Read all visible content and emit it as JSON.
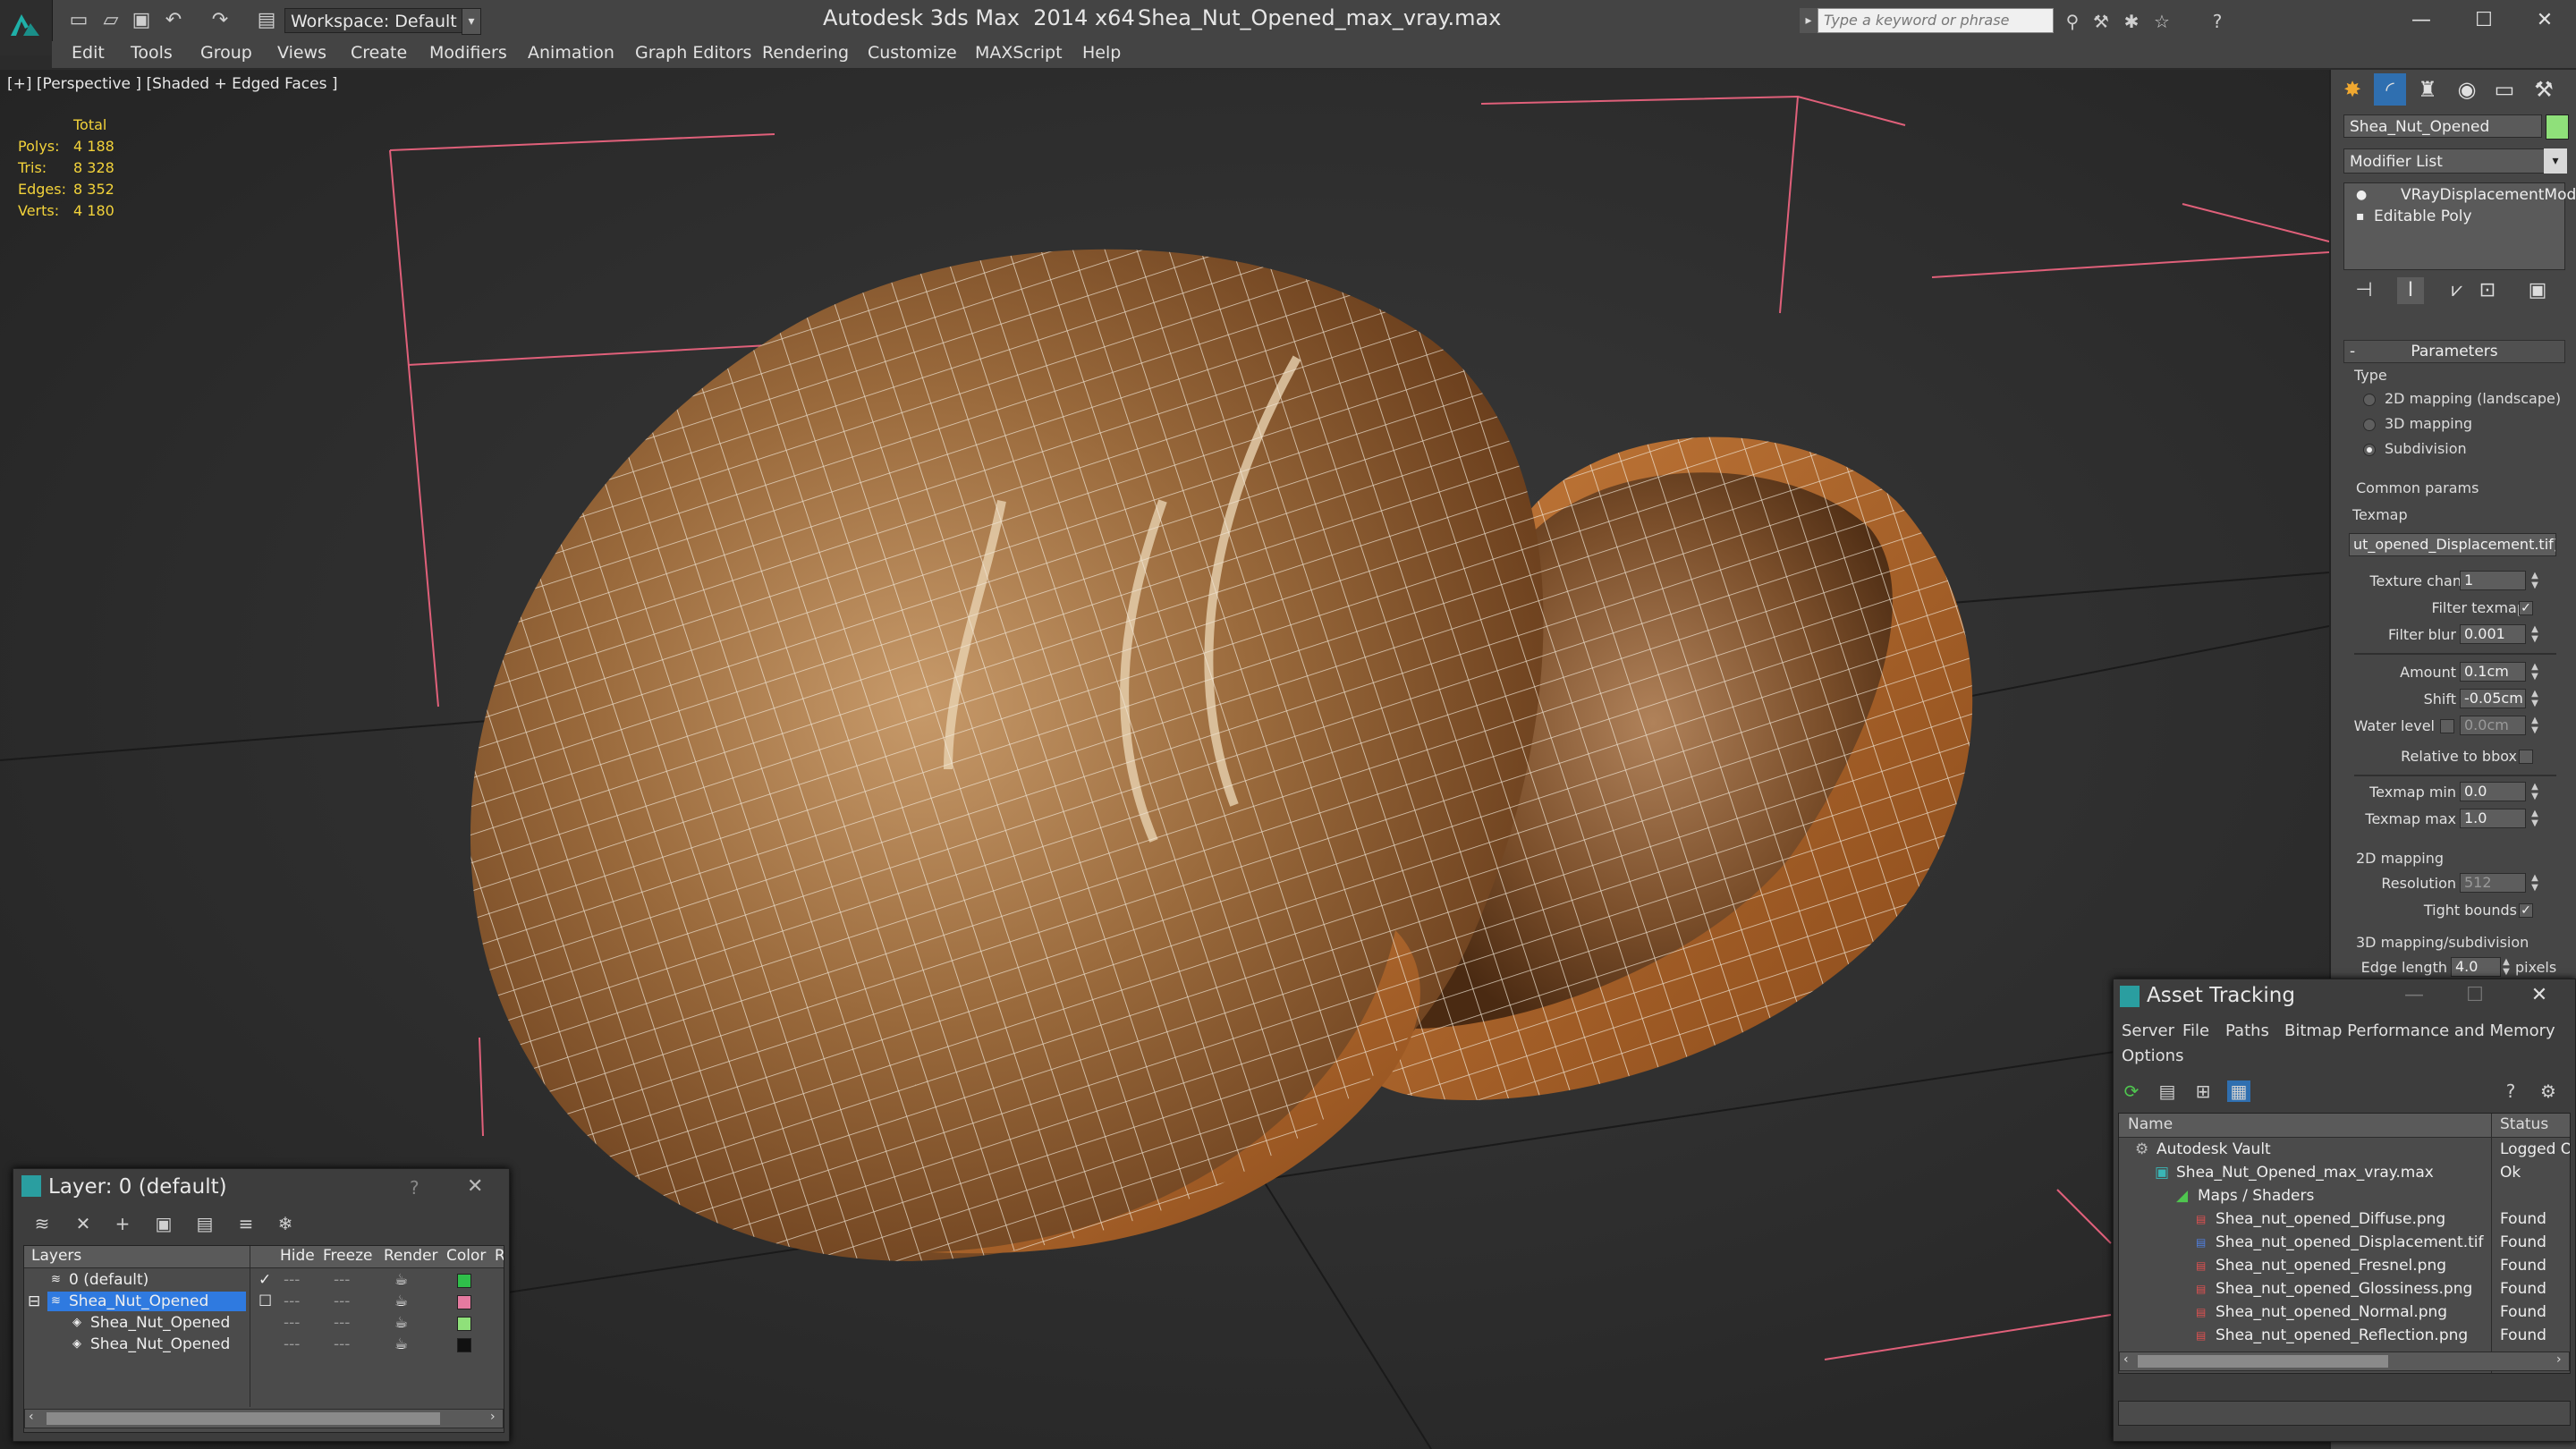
{
  "titlebar": {
    "workspace": "Workspace: Default",
    "app_title": "Autodesk 3ds Max  2014 x64",
    "doc_title": "Shea_Nut_Opened_max_vray.max",
    "search_placeholder": "Type a keyword or phrase"
  },
  "menu": [
    "Edit",
    "Tools",
    "Group",
    "Views",
    "Create",
    "Modifiers",
    "Animation",
    "Graph Editors",
    "Rendering",
    "Customize",
    "MAXScript",
    "Help"
  ],
  "viewport": {
    "label": "[+] [Perspective ] [Shaded + Edged Faces ]",
    "stats_header": "Total",
    "stats": [
      {
        "label": "Polys:",
        "value": "4 188"
      },
      {
        "label": "Tris:",
        "value": "8 328"
      },
      {
        "label": "Edges:",
        "value": "8 352"
      },
      {
        "label": "Verts:",
        "value": "4 180"
      }
    ]
  },
  "command_panel": {
    "object_name": "Shea_Nut_Opened",
    "object_color": "#8fe07a",
    "modifier_list": "Modifier List",
    "stack": [
      "VRayDisplacementMod",
      "Editable Poly"
    ],
    "rollout": "Parameters",
    "type_group": "Type",
    "type_options": [
      "2D mapping (landscape)",
      "3D mapping",
      "Subdivision"
    ],
    "type_selected": 2,
    "common_group": "Common params",
    "texmap_label": "Texmap",
    "texmap_value": "ut_opened_Displacement.tif)",
    "params": {
      "texture_chan_label": "Texture chan",
      "texture_chan": "1",
      "filter_texmap_label": "Filter texmap",
      "filter_blur_label": "Filter blur",
      "filter_blur": "0.001",
      "amount_label": "Amount",
      "amount": "0.1cm",
      "shift_label": "Shift",
      "shift": "-0.05cm",
      "water_level_label": "Water level",
      "water_level": "0.0cm",
      "relative_bbox_label": "Relative to bbox",
      "texmap_min_label": "Texmap min",
      "texmap_min": "0.0",
      "texmap_max_label": "Texmap max",
      "texmap_max": "1.0",
      "mapping2d_group": "2D mapping",
      "resolution_label": "Resolution",
      "resolution": "512",
      "tight_bounds_label": "Tight bounds",
      "mapping3d_group": "3D mapping/subdivision",
      "edge_length_label": "Edge length",
      "edge_length": "4.0",
      "edge_unit": "pixels"
    }
  },
  "asset_tracking": {
    "title": "Asset Tracking",
    "menu": [
      "Server",
      "File",
      "Paths",
      "Bitmap Performance and Memory",
      "Options"
    ],
    "col_name": "Name",
    "col_status": "Status",
    "rows": [
      {
        "name": "Autodesk Vault",
        "status": "Logged O",
        "indent": 0
      },
      {
        "name": "Shea_Nut_Opened_max_vray.max",
        "status": "Ok",
        "indent": 1
      },
      {
        "name": "Maps / Shaders",
        "status": "",
        "indent": 2
      },
      {
        "name": "Shea_nut_opened_Diffuse.png",
        "status": "Found",
        "indent": 3
      },
      {
        "name": "Shea_nut_opened_Displacement.tif",
        "status": "Found",
        "indent": 3
      },
      {
        "name": "Shea_nut_opened_Fresnel.png",
        "status": "Found",
        "indent": 3
      },
      {
        "name": "Shea_nut_opened_Glossiness.png",
        "status": "Found",
        "indent": 3
      },
      {
        "name": "Shea_nut_opened_Normal.png",
        "status": "Found",
        "indent": 3
      },
      {
        "name": "Shea_nut_opened_Reflection.png",
        "status": "Found",
        "indent": 3
      }
    ]
  },
  "layer_dialog": {
    "title": "Layer: 0 (default)",
    "help": "?",
    "columns": [
      "Layers",
      "Hide",
      "Freeze",
      "Render",
      "Color",
      "R"
    ],
    "rows": [
      {
        "name": "0 (default)",
        "color": "#2fbf4a"
      },
      {
        "name": "Shea_Nut_Opened",
        "color": "#e57aa0"
      },
      {
        "name": "Shea_Nut_Opened",
        "color": "#8fe07a"
      },
      {
        "name": "Shea_Nut_Opened",
        "color": "#111111"
      }
    ]
  }
}
